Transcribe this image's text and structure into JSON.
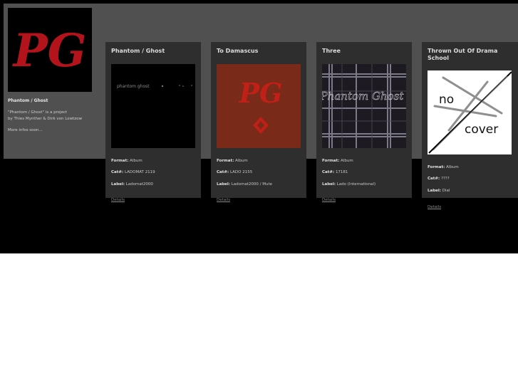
{
  "artist": {
    "name": "Phantom / Ghost",
    "description_line1": "\"Phantom / Ghost\" is a project",
    "description_line2": "by Thies Mynther & Dirk von Lowtzow",
    "more": "More infos soon...",
    "logo_text": "PG"
  },
  "labels": {
    "format": "Format:",
    "cat": "Cat#:",
    "label": "Label:"
  },
  "releases": [
    {
      "title": "Phantom / Ghost",
      "format": "Album",
      "cat": "LADOMAT 2119",
      "label": "Ladomat2000",
      "details": "Details",
      "cover_text": "phantom ghost"
    },
    {
      "title": "To Damascus",
      "format": "Album",
      "cat": "LADO 2155",
      "label": "Ladomat2000 / Mute",
      "details": "Details",
      "cover_text": "PG"
    },
    {
      "title": "Three",
      "format": "Album",
      "cat": "17181",
      "label": "Lado (International)",
      "details": "Details",
      "cover_text": "Phantom Ghost"
    },
    {
      "title": "Thrown Out Of Drama School",
      "format": "Album",
      "cat": "????",
      "label": "Dial",
      "details": "Details",
      "cover_text_1": "no",
      "cover_text_2": "cover"
    }
  ],
  "colors": {
    "accent_red": "#b3141c",
    "cover_red": "#7a2a18",
    "band": "#505050",
    "card": "#2e2e2e"
  }
}
